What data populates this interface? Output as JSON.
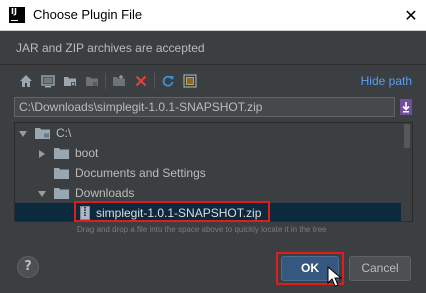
{
  "window": {
    "title": "Choose Plugin File",
    "close_glyph": "✕",
    "app_icon_text": "IJ"
  },
  "description": "JAR and ZIP archives are accepted",
  "toolbar": {
    "buttons": [
      "home-icon",
      "desktop-icon",
      "project-folder-icon",
      "module-folder-icon",
      "new-folder-icon",
      "delete-icon",
      "refresh-icon",
      "show-hidden-icon"
    ],
    "hide_path_label": "Hide path"
  },
  "path_field": {
    "value": "C:\\Downloads\\simplegit-1.0.1-SNAPSHOT.zip"
  },
  "tree": {
    "items": [
      {
        "label": "C:\\",
        "expanded": true
      },
      {
        "label": "boot",
        "expanded": false
      },
      {
        "label": "Documents and Settings",
        "expanded": false
      },
      {
        "label": "Downloads",
        "expanded": true
      },
      {
        "label": "simplegit-1.0.1-SNAPSHOT.zip",
        "selected": true
      }
    ]
  },
  "hint": "Drag and drop a file into the space above to quickly locate it in the tree",
  "buttons": {
    "help_label": "?",
    "ok_label": "OK",
    "cancel_label": "Cancel"
  },
  "colors": {
    "background": "#3c3f41",
    "link": "#589df6",
    "selection": "#0d293e",
    "ok_button": "#365880",
    "annotation_red": "#e01c1c"
  }
}
